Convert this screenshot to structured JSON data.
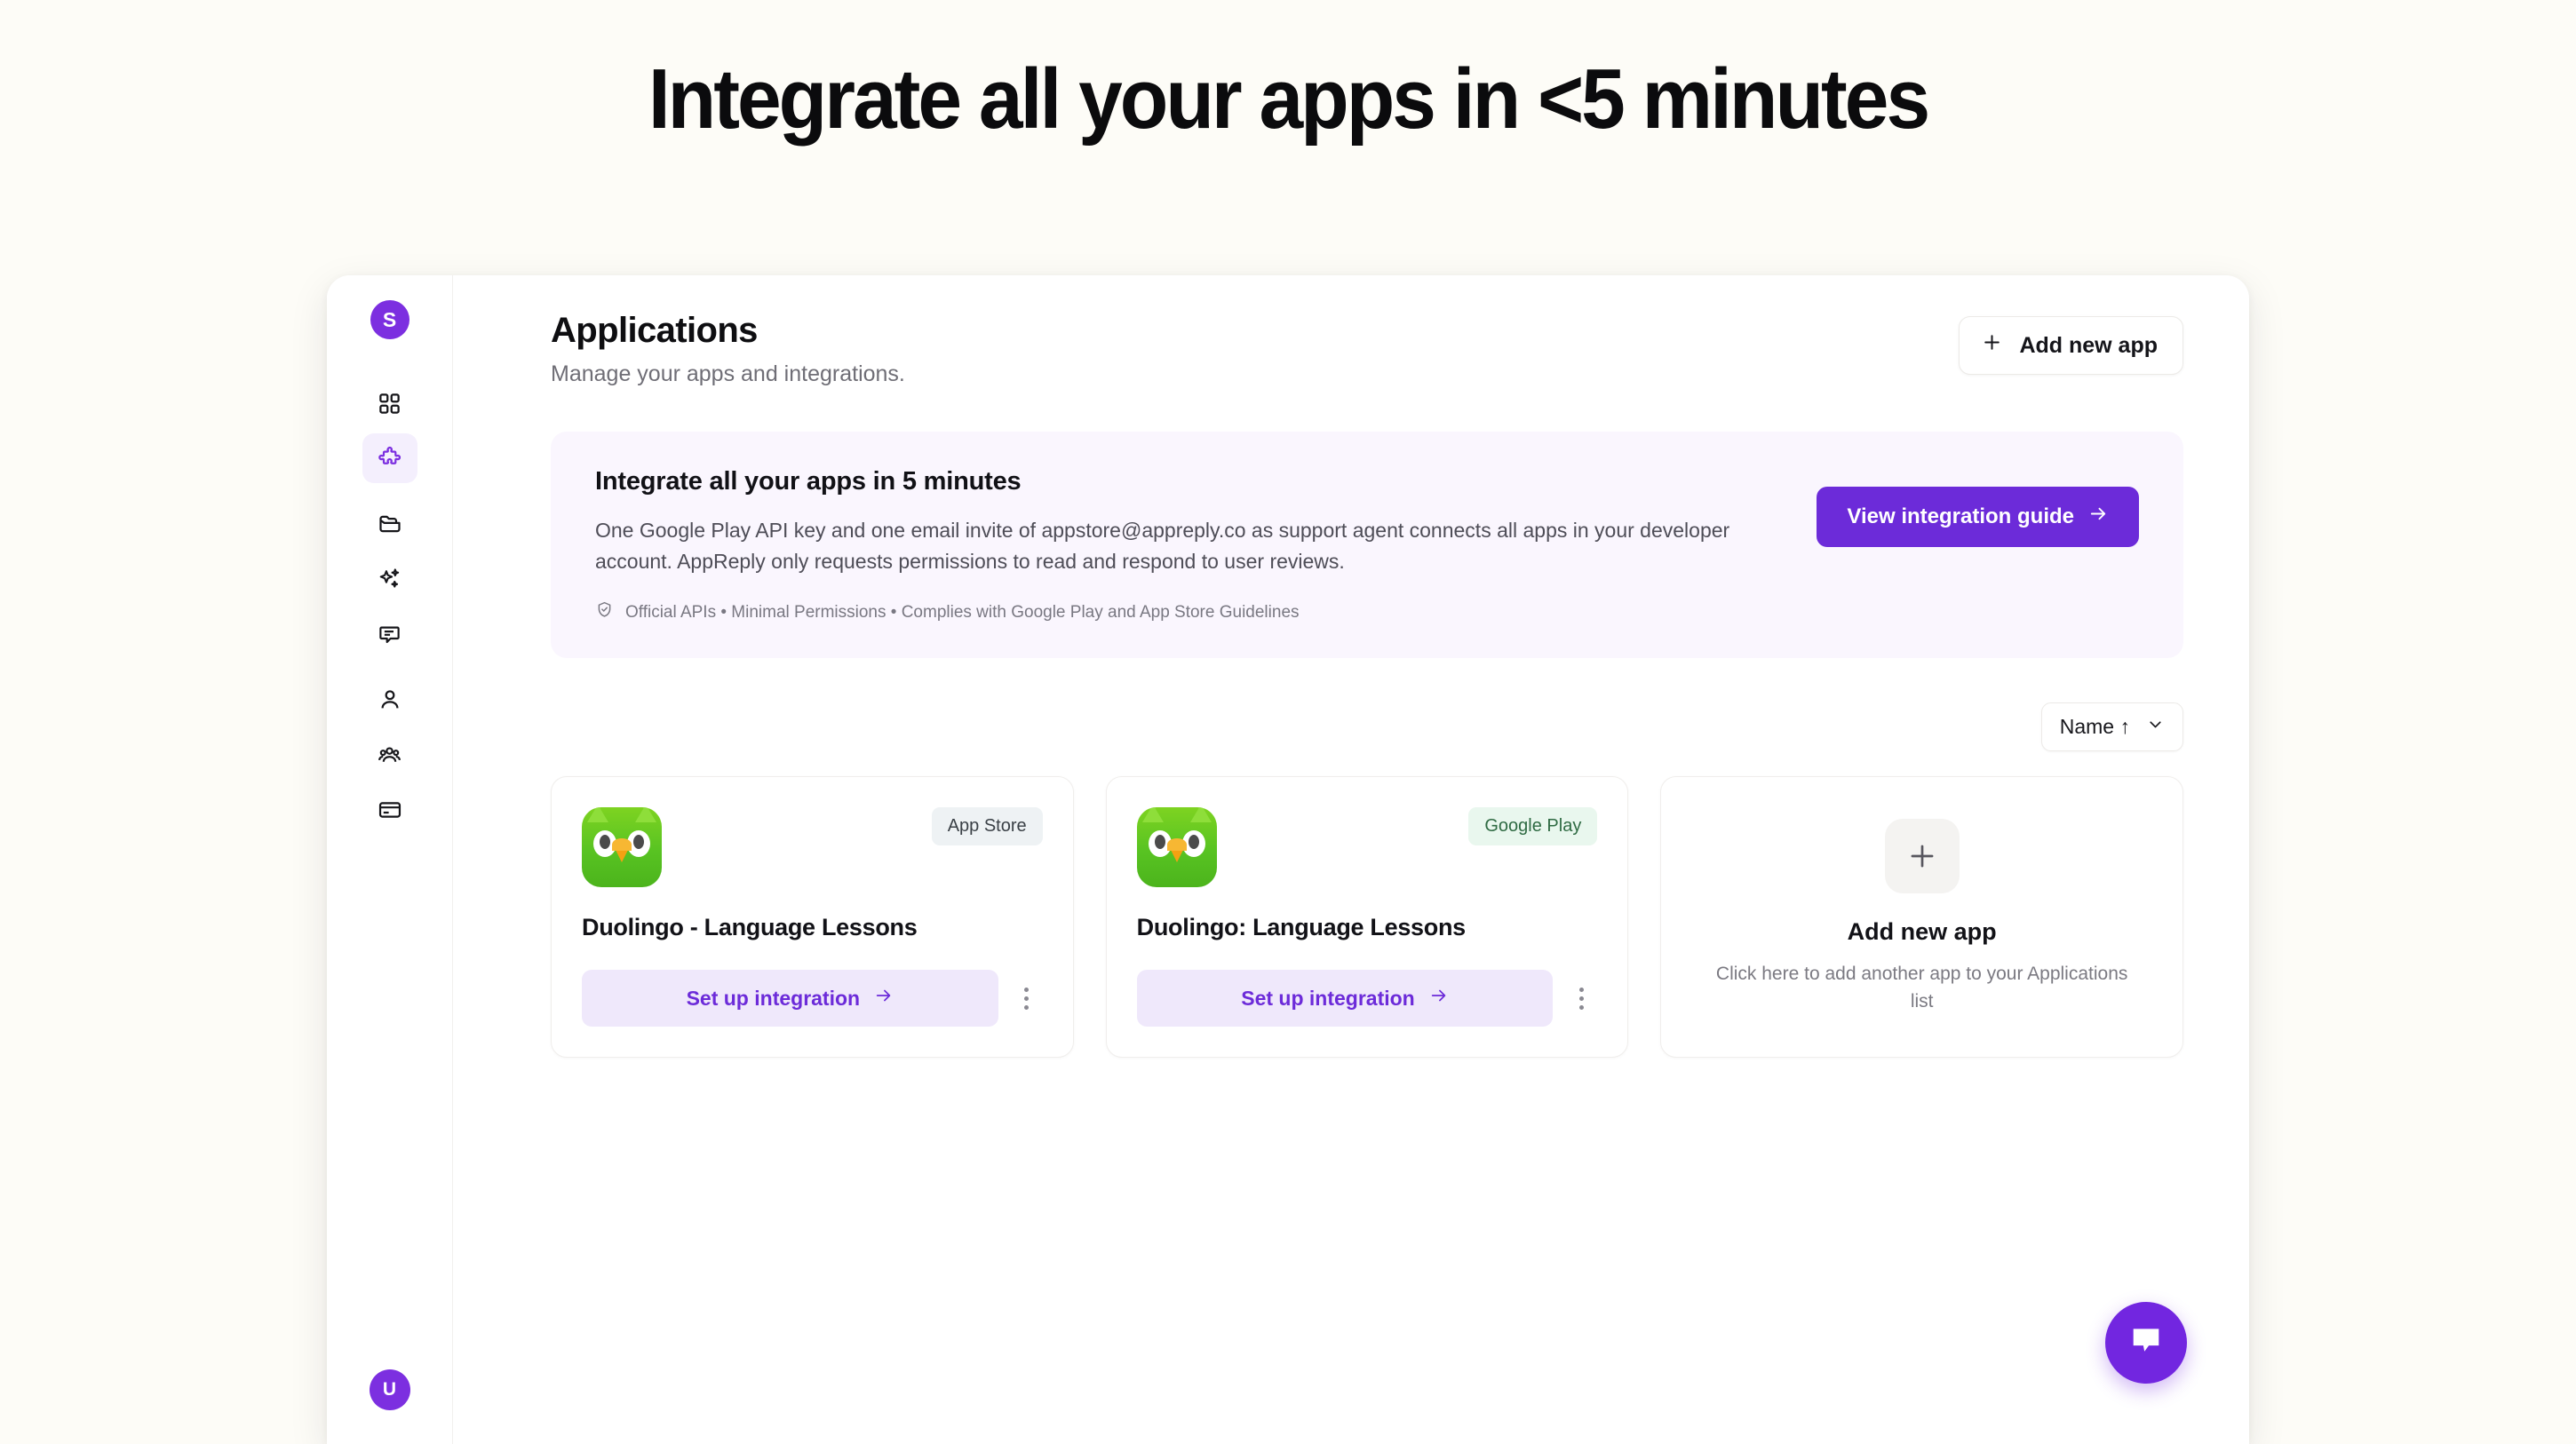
{
  "hero": {
    "title": "Integrate all your apps in <5 minutes"
  },
  "sidebar": {
    "brand_initial": "S",
    "items": [
      {
        "label": "Dashboard",
        "icon": "grid-icon",
        "active": false
      },
      {
        "label": "Integrations",
        "icon": "puzzle-icon",
        "active": true
      },
      {
        "label": "Folders",
        "icon": "folder-icon",
        "active": false
      },
      {
        "label": "AI Assistant",
        "icon": "sparkles-icon",
        "active": false
      },
      {
        "label": "Messages",
        "icon": "chat-bubble-icon",
        "active": false
      },
      {
        "label": "Profile",
        "icon": "user-icon",
        "active": false
      },
      {
        "label": "Team",
        "icon": "users-group-icon",
        "active": false
      },
      {
        "label": "Billing",
        "icon": "credit-card-icon",
        "active": false
      }
    ],
    "user_initial": "U",
    "collapse_icon": "arrow-right-circle-icon"
  },
  "header": {
    "title": "Applications",
    "subtitle": "Manage your apps and integrations.",
    "add_new_app_label": "Add new app",
    "add_new_app_icon": "plus-icon"
  },
  "promo": {
    "title": "Integrate all your apps in 5 minutes",
    "body": "One Google Play API key and one email invite of appstore@appreply.co as support agent connects all apps in your developer account. AppReply only requests permissions to read and respond to user reviews.",
    "footnote": "Official APIs • Minimal Permissions • Complies with Google Play and App Store Guidelines",
    "footnote_icon": "shield-check-icon",
    "cta_label": "View integration guide",
    "cta_icon": "arrow-right-icon",
    "accent_color": "#6c2bd9",
    "background_color": "#faf6fe"
  },
  "toolbar": {
    "sort_label": "Name ↑",
    "sort_icon": "chevron-down-icon"
  },
  "apps": [
    {
      "name": "Duolingo - Language Lessons",
      "store": "App Store",
      "store_style": "appstore",
      "action_label": "Set up integration",
      "action_icon": "arrow-right-icon",
      "menu_icon": "kebab-menu-icon"
    },
    {
      "name": "Duolingo: Language Lessons",
      "store": "Google Play",
      "store_style": "googleplay",
      "action_label": "Set up integration",
      "action_icon": "arrow-right-icon",
      "menu_icon": "kebab-menu-icon"
    }
  ],
  "add_card": {
    "icon": "plus-icon",
    "title": "Add new app",
    "subtitle": "Click here to add another app to your Applications list"
  },
  "chat_widget": {
    "icon": "chat-bubble-icon",
    "color": "#7226e0"
  }
}
